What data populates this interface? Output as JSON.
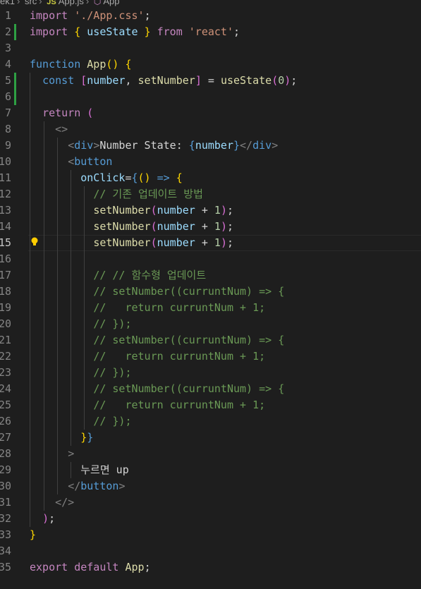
{
  "breadcrumb": {
    "items": [
      "ek1",
      "src",
      "App.js",
      "App"
    ],
    "file_icon": "js-file-icon",
    "symbol_icon": "symbol-cube-icon"
  },
  "editor": {
    "active_line": 15,
    "lines": [
      {
        "n": "1",
        "tokens": [
          [
            "kw",
            "import"
          ],
          [
            "pl",
            " "
          ],
          [
            "st",
            "'./App.css'"
          ],
          [
            "pl",
            ";"
          ]
        ]
      },
      {
        "n": "2",
        "tokens": [
          [
            "kw",
            "import"
          ],
          [
            "pl",
            " "
          ],
          [
            "br1",
            "{"
          ],
          [
            "pl",
            " "
          ],
          [
            "vr",
            "useState"
          ],
          [
            "pl",
            " "
          ],
          [
            "br1",
            "}"
          ],
          [
            "pl",
            " "
          ],
          [
            "kw",
            "from"
          ],
          [
            "pl",
            " "
          ],
          [
            "st",
            "'react'"
          ],
          [
            "pl",
            ";"
          ]
        ]
      },
      {
        "n": "3",
        "tokens": []
      },
      {
        "n": "4",
        "tokens": [
          [
            "kb",
            "function"
          ],
          [
            "pl",
            " "
          ],
          [
            "fnc",
            "App"
          ],
          [
            "br1",
            "()"
          ],
          [
            "pl",
            " "
          ],
          [
            "br1",
            "{"
          ]
        ]
      },
      {
        "n": "5",
        "tokens": [
          [
            "pl",
            "  "
          ],
          [
            "kb",
            "const"
          ],
          [
            "pl",
            " "
          ],
          [
            "br2",
            "["
          ],
          [
            "vr",
            "number"
          ],
          [
            "pl",
            ", "
          ],
          [
            "fnc",
            "setNumber"
          ],
          [
            "br2",
            "]"
          ],
          [
            "pl",
            " = "
          ],
          [
            "fnc",
            "useState"
          ],
          [
            "br2",
            "("
          ],
          [
            "nm",
            "0"
          ],
          [
            "br2",
            ")"
          ],
          [
            "pl",
            ";"
          ]
        ]
      },
      {
        "n": "6",
        "tokens": []
      },
      {
        "n": "7",
        "tokens": [
          [
            "pl",
            "  "
          ],
          [
            "kw",
            "return"
          ],
          [
            "pl",
            " "
          ],
          [
            "br2",
            "("
          ]
        ]
      },
      {
        "n": "8",
        "tokens": [
          [
            "pl",
            "    "
          ],
          [
            "tg",
            "<>"
          ]
        ]
      },
      {
        "n": "9",
        "tokens": [
          [
            "pl",
            "      "
          ],
          [
            "tg",
            "<"
          ],
          [
            "kb",
            "div"
          ],
          [
            "tg",
            ">"
          ],
          [
            "pl",
            "Number State: "
          ],
          [
            "kb",
            "{"
          ],
          [
            "vr",
            "number"
          ],
          [
            "kb",
            "}"
          ],
          [
            "tg",
            "</"
          ],
          [
            "kb",
            "div"
          ],
          [
            "tg",
            ">"
          ]
        ]
      },
      {
        "n": "10",
        "tokens": [
          [
            "pl",
            "      "
          ],
          [
            "tg",
            "<"
          ],
          [
            "kb",
            "button"
          ]
        ]
      },
      {
        "n": "11",
        "tokens": [
          [
            "pl",
            "        "
          ],
          [
            "vr",
            "onClick"
          ],
          [
            "pl",
            "="
          ],
          [
            "kb",
            "{"
          ],
          [
            "br1",
            "()"
          ],
          [
            "pl",
            " "
          ],
          [
            "kb",
            "=>"
          ],
          [
            "pl",
            " "
          ],
          [
            "br1",
            "{"
          ]
        ]
      },
      {
        "n": "12",
        "tokens": [
          [
            "pl",
            "          "
          ],
          [
            "cm",
            "// 기존 업데이트 방법"
          ]
        ]
      },
      {
        "n": "13",
        "tokens": [
          [
            "pl",
            "          "
          ],
          [
            "fnc",
            "setNumber"
          ],
          [
            "br2",
            "("
          ],
          [
            "vr",
            "number"
          ],
          [
            "pl",
            " + "
          ],
          [
            "nm",
            "1"
          ],
          [
            "br2",
            ")"
          ],
          [
            "pl",
            ";"
          ]
        ]
      },
      {
        "n": "14",
        "tokens": [
          [
            "pl",
            "          "
          ],
          [
            "fnc",
            "setNumber"
          ],
          [
            "br2",
            "("
          ],
          [
            "vr",
            "number"
          ],
          [
            "pl",
            " + "
          ],
          [
            "nm",
            "1"
          ],
          [
            "br2",
            ")"
          ],
          [
            "pl",
            ";"
          ]
        ]
      },
      {
        "n": "15",
        "tokens": [
          [
            "pl",
            "          "
          ],
          [
            "fnc",
            "setNumber"
          ],
          [
            "br2",
            "("
          ],
          [
            "vr",
            "number"
          ],
          [
            "pl",
            " + "
          ],
          [
            "nm",
            "1"
          ],
          [
            "br2",
            ")"
          ],
          [
            "pl",
            ";"
          ]
        ]
      },
      {
        "n": "16",
        "tokens": []
      },
      {
        "n": "17",
        "tokens": [
          [
            "pl",
            "          "
          ],
          [
            "cm",
            "// // 함수형 업데이트"
          ]
        ]
      },
      {
        "n": "18",
        "tokens": [
          [
            "pl",
            "          "
          ],
          [
            "cm",
            "// setNumber((curruntNum) => {"
          ]
        ]
      },
      {
        "n": "19",
        "tokens": [
          [
            "pl",
            "          "
          ],
          [
            "cm",
            "//   return curruntNum + 1;"
          ]
        ]
      },
      {
        "n": "20",
        "tokens": [
          [
            "pl",
            "          "
          ],
          [
            "cm",
            "// });"
          ]
        ]
      },
      {
        "n": "21",
        "tokens": [
          [
            "pl",
            "          "
          ],
          [
            "cm",
            "// setNumber((curruntNum) => {"
          ]
        ]
      },
      {
        "n": "22",
        "tokens": [
          [
            "pl",
            "          "
          ],
          [
            "cm",
            "//   return curruntNum + 1;"
          ]
        ]
      },
      {
        "n": "23",
        "tokens": [
          [
            "pl",
            "          "
          ],
          [
            "cm",
            "// });"
          ]
        ]
      },
      {
        "n": "24",
        "tokens": [
          [
            "pl",
            "          "
          ],
          [
            "cm",
            "// setNumber((curruntNum) => {"
          ]
        ]
      },
      {
        "n": "25",
        "tokens": [
          [
            "pl",
            "          "
          ],
          [
            "cm",
            "//   return curruntNum + 1;"
          ]
        ]
      },
      {
        "n": "26",
        "tokens": [
          [
            "pl",
            "          "
          ],
          [
            "cm",
            "// });"
          ]
        ]
      },
      {
        "n": "27",
        "tokens": [
          [
            "pl",
            "        "
          ],
          [
            "br1",
            "}"
          ],
          [
            "kb",
            "}"
          ]
        ]
      },
      {
        "n": "28",
        "tokens": [
          [
            "pl",
            "      "
          ],
          [
            "tg",
            ">"
          ]
        ]
      },
      {
        "n": "29",
        "tokens": [
          [
            "pl",
            "        "
          ],
          [
            "pl",
            "누르면 up"
          ]
        ]
      },
      {
        "n": "30",
        "tokens": [
          [
            "pl",
            "      "
          ],
          [
            "tg",
            "</"
          ],
          [
            "kb",
            "button"
          ],
          [
            "tg",
            ">"
          ]
        ]
      },
      {
        "n": "31",
        "tokens": [
          [
            "pl",
            "    "
          ],
          [
            "tg",
            "</>"
          ]
        ]
      },
      {
        "n": "32",
        "tokens": [
          [
            "pl",
            "  "
          ],
          [
            "br2",
            ")"
          ],
          [
            "pl",
            ";"
          ]
        ]
      },
      {
        "n": "33",
        "tokens": [
          [
            "br1",
            "}"
          ]
        ]
      },
      {
        "n": "34",
        "tokens": []
      },
      {
        "n": "35",
        "tokens": [
          [
            "kw",
            "export"
          ],
          [
            "pl",
            " "
          ],
          [
            "kw",
            "default"
          ],
          [
            "pl",
            " "
          ],
          [
            "fnc",
            "App"
          ],
          [
            "pl",
            ";"
          ]
        ]
      }
    ]
  },
  "colors": {
    "background": "#1e1e1e",
    "git_added": "#2ea043",
    "keyword": "#c586c0",
    "string": "#ce9178",
    "function": "#dcdcaa",
    "comment": "#6a9955"
  }
}
